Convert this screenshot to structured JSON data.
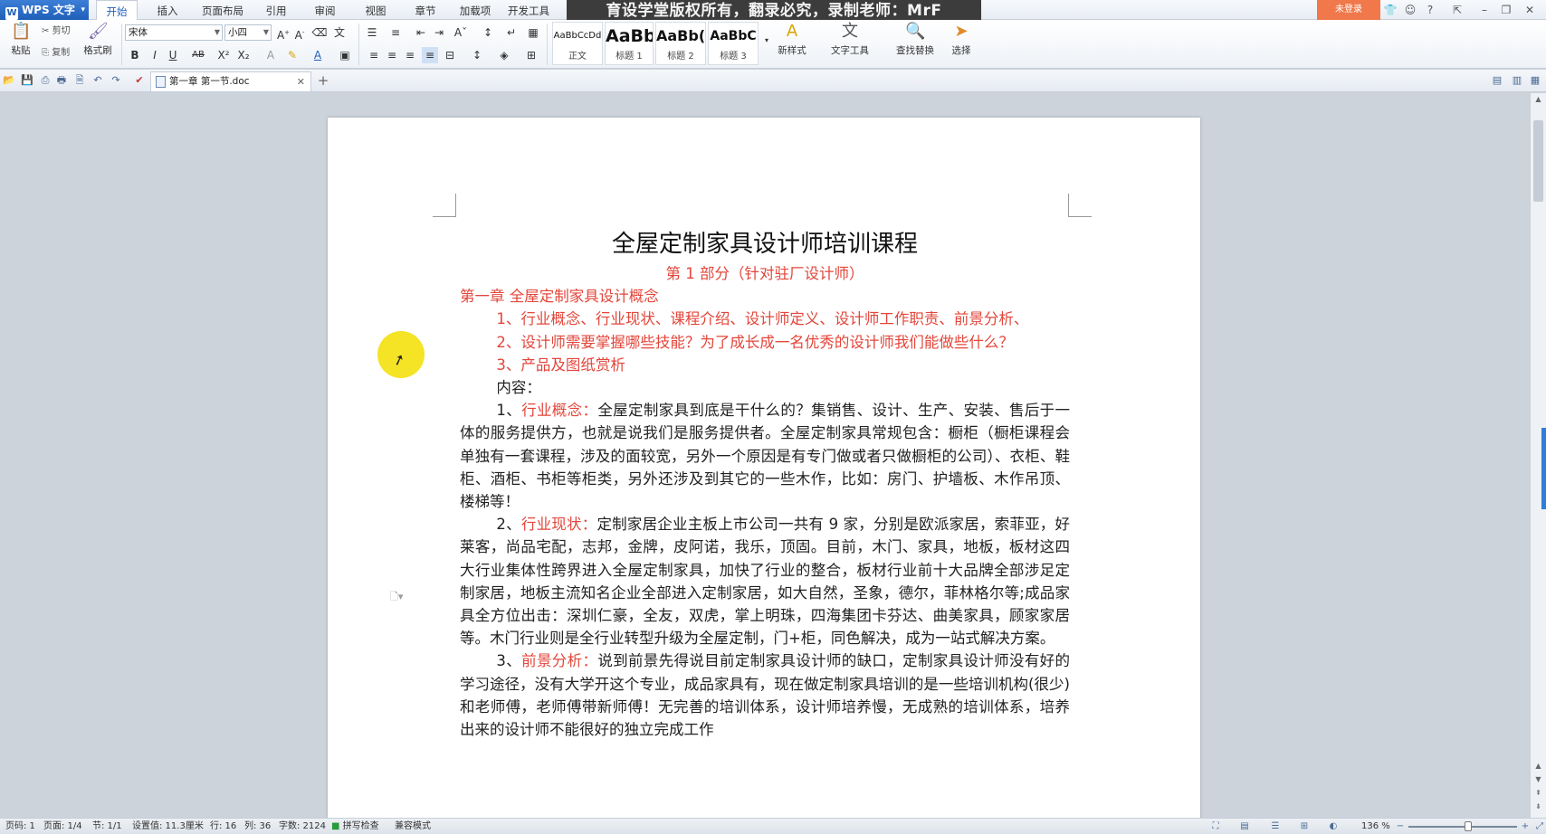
{
  "app": {
    "name": "WPS 文字",
    "logo_letter": "W"
  },
  "ribbon_tabs": [
    {
      "label": "开始",
      "active": true
    },
    {
      "label": "插入"
    },
    {
      "label": "页面布局"
    },
    {
      "label": "引用"
    },
    {
      "label": "审阅"
    },
    {
      "label": "视图"
    },
    {
      "label": "章节"
    },
    {
      "label": "加载项"
    },
    {
      "label": "开发工具"
    }
  ],
  "watermark_banner": "育设学堂版权所有，翻录必究，录制老师：MrF",
  "login_label": "未登录",
  "ribbon": {
    "paste": "粘贴",
    "cut": "剪切",
    "copy": "复制",
    "format_painter": "格式刷",
    "font_name": "宋体",
    "font_size": "小四",
    "styles": [
      {
        "sample": "AaBbCcDd",
        "name": "正文"
      },
      {
        "sample": "AaBb",
        "name": "标题 1"
      },
      {
        "sample": "AaBb(",
        "name": "标题 2"
      },
      {
        "sample": "AaBbC",
        "name": "标题 3"
      }
    ],
    "new_style": "新样式",
    "text_tools": "文字工具",
    "find_replace": "查找替换",
    "select": "选择"
  },
  "doc_tab": {
    "label": "第一章  第一节.doc"
  },
  "document": {
    "title": "全屋定制家具设计师培训课程",
    "part": "第 1 部分（针对驻厂设计师）",
    "chapter": "第一章   全屋定制家具设计概念",
    "items": [
      "1、行业概念、行业现状、课程介绍、设计师定义、设计师工作职责、前景分析、",
      "2、设计师需要掌握哪些技能？为了成长成一名优秀的设计师我们能做些什么？",
      "3、产品及图纸赏析"
    ],
    "content_label": "内容：",
    "paragraphs": [
      {
        "num": "1、",
        "key": "行业概念：",
        "text": "全屋定制家具到底是干什么的？集销售、设计、生产、安装、售后于一体的服务提供方，也就是说我们是服务提供者。全屋定制家具常规包含：橱柜（橱柜课程会单独有一套课程，涉及的面较宽，另外一个原因是有专门做或者只做橱柜的公司）、衣柜、鞋柜、酒柜、书柜等柜类，另外还涉及到其它的一些木作，比如：房门、护墙板、木作吊顶、楼梯等！"
      },
      {
        "num": "2、",
        "key": "行业现状：",
        "text": "定制家居企业主板上市公司一共有 9 家，分别是欧派家居，索菲亚，好莱客，尚品宅配，志邦，金牌，皮阿诺，我乐，顶固。目前，木门、家具，地板，板材这四大行业集体性跨界进入全屋定制家具，加快了行业的整合，板材行业前十大品牌全部涉足定制家居，地板主流知名企业全部进入定制家居，如大自然，圣象，德尔，菲林格尔等;成品家具全方位出击：深圳仁豪，全友，双虎，掌上明珠，四海集团卡芬达、曲美家具，顾家家居等。木门行业则是全行业转型升级为全屋定制，门+柜，同色解决，成为一站式解决方案。"
      },
      {
        "num": "3、",
        "key": "前景分析：",
        "text": "说到前景先得说目前定制家具设计师的缺口，定制家具设计师没有好的学习途径，没有大学开这个专业，成品家具有，现在做定制家具培训的是一些培训机构(很少)和老师傅，老师傅带新师傅！无完善的培训体系，设计师培养慢，无成熟的培训体系，培养出来的设计师不能很好的独立完成工作"
      }
    ]
  },
  "status": {
    "page_code": "页码: 1",
    "page": "页面: 1/4",
    "section": "节: 1/1",
    "setting": "设置值: 11.3厘米",
    "row": "行: 16",
    "col": "列: 36",
    "word_count": "字数: 2124",
    "spell_check": "拼写检查",
    "compat": "兼容模式",
    "zoom": "136 %"
  },
  "colors": {
    "accent": "#1f5fb8",
    "heading_red": "#e3463b",
    "login": "#f0784a"
  }
}
